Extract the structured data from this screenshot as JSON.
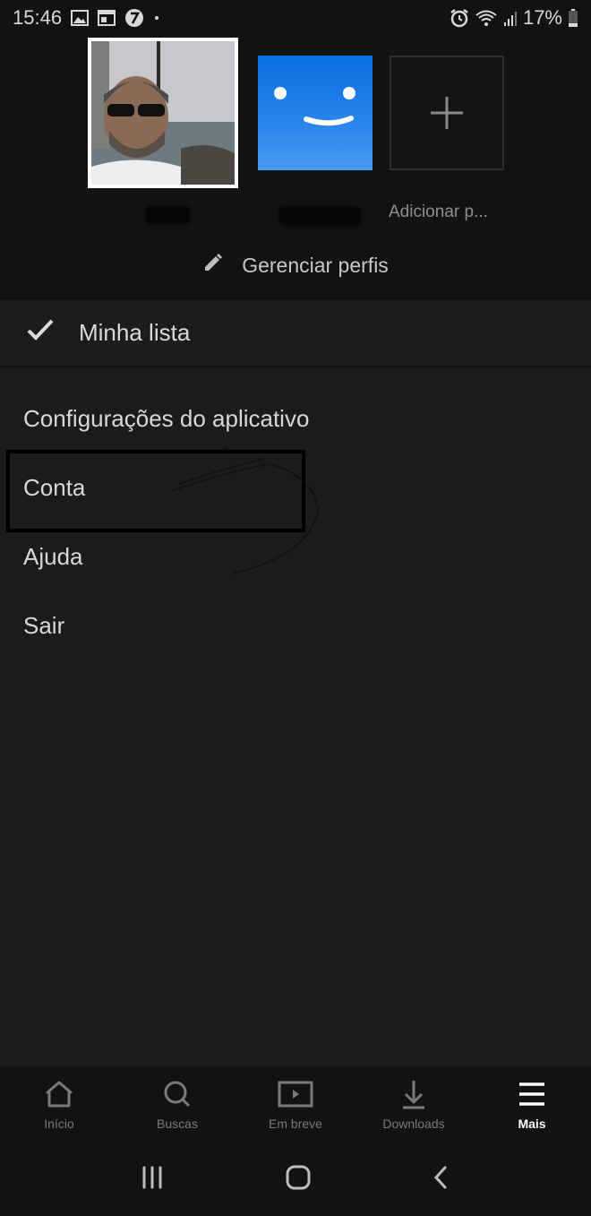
{
  "status_bar": {
    "time": "15:46",
    "left_icons": [
      "image-icon",
      "calendar-icon",
      "app-icon",
      "dot-icon"
    ],
    "right_icons": [
      "alarm-icon",
      "wifi-icon",
      "signal-icon"
    ],
    "battery": "17%"
  },
  "profiles": [
    {
      "name": "",
      "type": "photo",
      "selected": true,
      "redacted": true
    },
    {
      "name": "",
      "type": "smiley",
      "color": "#1a7ae8",
      "redacted": true
    },
    {
      "name": "Adicionar p...",
      "type": "add"
    }
  ],
  "manage_profiles": {
    "label": "Gerenciar perfis"
  },
  "my_list": {
    "label": "Minha lista"
  },
  "menu": {
    "items": [
      {
        "label": "Configurações do aplicativo"
      },
      {
        "label": "Conta",
        "highlighted": true
      },
      {
        "label": "Ajuda"
      },
      {
        "label": "Sair"
      }
    ]
  },
  "bottom_nav": {
    "items": [
      {
        "label": "Início",
        "icon": "home-icon"
      },
      {
        "label": "Buscas",
        "icon": "search-icon"
      },
      {
        "label": "Em breve",
        "icon": "coming-soon-icon"
      },
      {
        "label": "Downloads",
        "icon": "download-icon"
      },
      {
        "label": "Mais",
        "icon": "menu-icon",
        "active": true
      }
    ]
  },
  "colors": {
    "background": "#1b1b1b",
    "header_background": "#121212",
    "profile_blue": "#1a7ae8",
    "active_nav": "#ffffff",
    "inactive_nav": "#7a7a7a"
  }
}
